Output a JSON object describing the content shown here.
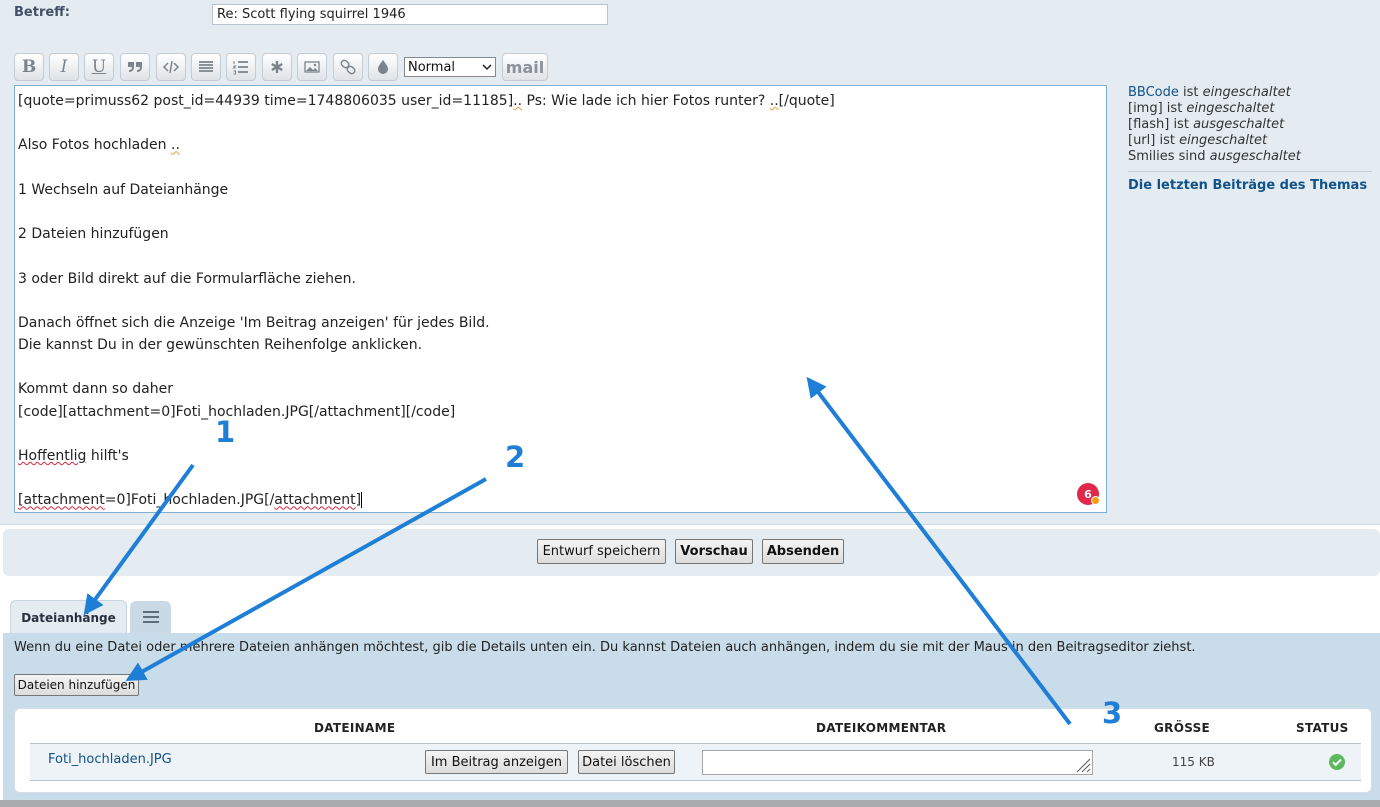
{
  "form": {
    "subject_label": "Betreff:",
    "subject_value": "Re: Scott flying squirrel 1946"
  },
  "toolbar": {
    "bold": "B",
    "italic": "I",
    "underline": "U",
    "size_select": "Normal",
    "mail": "mail",
    "icons": [
      "quote-icon",
      "code-icon",
      "list-icon",
      "ordered-list-icon",
      "asterisk-icon",
      "image-icon",
      "link-icon",
      "color-drop-icon"
    ]
  },
  "editor": {
    "line_quote_prefix": "[quote=primuss62 post_id=44939 time=1748806035 user_id=11185]",
    "line_quote_dots": "..",
    "line_quote_mid": " Ps: Wie lade ich hier Fotos runter? ",
    "line_quote_dots2": "..",
    "line_quote_suffix": "[/quote]",
    "line_fotos": "Also Fotos hochladen ",
    "line_fotos_dots": "..",
    "line_step1": "1 Wechseln auf Dateianhänge",
    "line_step2": "2 Dateien hinzufügen",
    "line_step3": "3 oder Bild direkt auf die Formularfläche ziehen.",
    "line_danach": "Danach öffnet sich die Anzeige 'Im Beitrag anzeigen' für jedes Bild.",
    "line_kannst": "Die kannst Du in der gewünschten Reihenfolge anklicken.",
    "line_kommt": "Kommt dann so daher",
    "line_code": "[code][attachment=0]Foti_hochladen.JPG[/attachment][/code]",
    "line_hoff_word": "Hoffentlig",
    "line_hoff_rest": " hilft's",
    "line_att_open": "[attachment",
    "line_att_mid": "=0]Foti_hochladen.JPG[/",
    "line_att_close": "attachment",
    "line_att_end": "]",
    "badge_count": "6"
  },
  "sidebar": {
    "bbcode_link": "BBCode",
    "ist": " ist ",
    "enabled": "eingeschaltet",
    "disabled": "ausgeschaltet",
    "img": "[img] ist ",
    "flash": "[flash] ist ",
    "url": "[url] ist ",
    "smilies": "Smilies sind ",
    "last_posts": "Die letzten Beiträge des Themas"
  },
  "buttons": {
    "save_draft": "Entwurf speichern",
    "preview": "Vorschau",
    "submit": "Absenden"
  },
  "attachments": {
    "tab_label": "Dateianhänge",
    "description": "Wenn du eine Datei oder mehrere Dateien anhängen möchtest, gib die Details unten ein. Du kannst Dateien auch anhängen, indem du sie mit der Maus in den Beitragseditor ziehst.",
    "add_files": "Dateien hinzufügen",
    "columns": {
      "filename": "DATEINAME",
      "comment": "DATEIKOMMENTAR",
      "size": "GRÖSSE",
      "status": "STATUS"
    },
    "file": {
      "name": "Foti_hochladen.JPG",
      "show_in_post": "Im Beitrag anzeigen",
      "delete": "Datei löschen",
      "size": "115 KB"
    }
  },
  "annotations": {
    "label1": "1",
    "label2": "2",
    "label3": "3",
    "color": "#1f7fd6"
  }
}
